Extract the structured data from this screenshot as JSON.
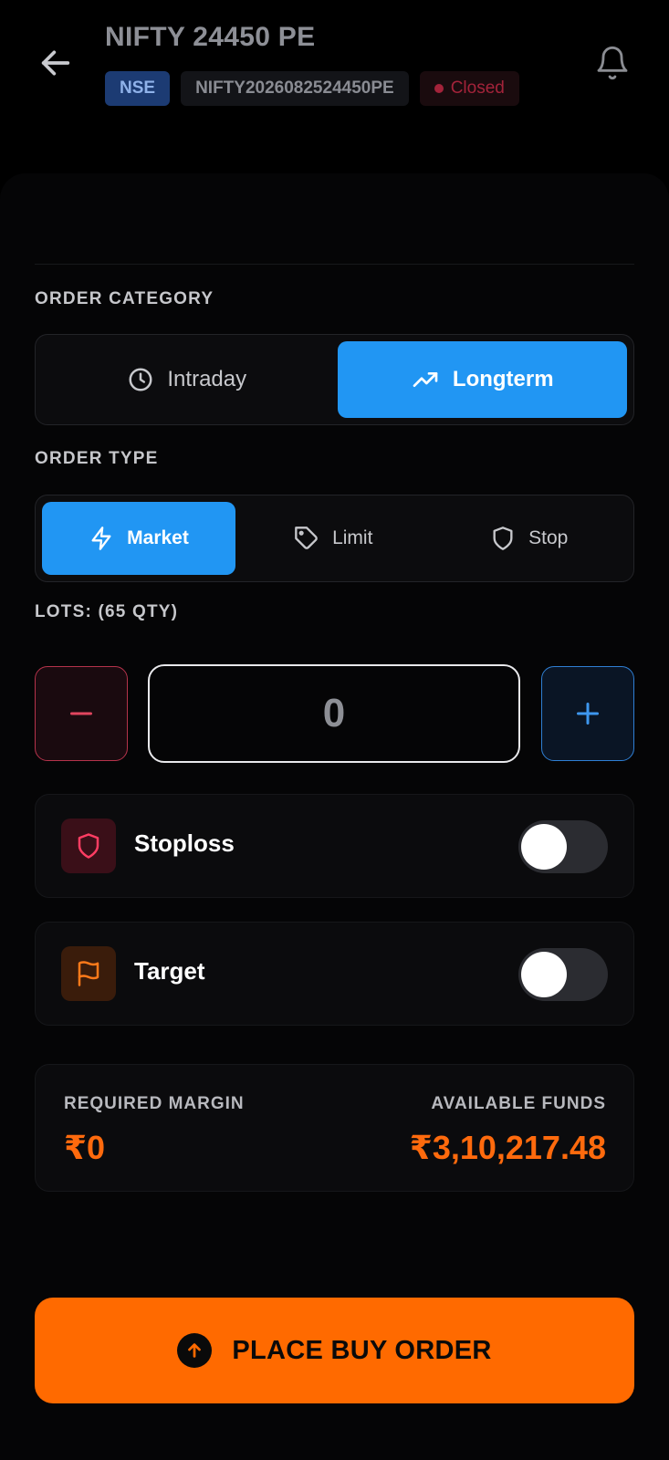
{
  "header": {
    "title": "NIFTY 24450 PE",
    "exchange": "NSE",
    "symbol": "NIFTY2026082524450PE",
    "status": "Closed"
  },
  "order_category": {
    "label": "ORDER CATEGORY",
    "options": [
      {
        "label": "Intraday",
        "icon": "clock-icon",
        "active": false
      },
      {
        "label": "Longterm",
        "icon": "trending-up-icon",
        "active": true
      }
    ]
  },
  "order_type": {
    "label": "ORDER TYPE",
    "options": [
      {
        "label": "Market",
        "icon": "lightning-icon",
        "active": true
      },
      {
        "label": "Limit",
        "icon": "tag-icon",
        "active": false
      },
      {
        "label": "Stop",
        "icon": "shield-icon",
        "active": false
      }
    ]
  },
  "lots": {
    "label": "LOTS: (65 QTY)",
    "value": "0"
  },
  "stoploss": {
    "label": "Stoploss",
    "enabled": false
  },
  "target": {
    "label": "Target",
    "enabled": false
  },
  "margin": {
    "required_label": "REQUIRED MARGIN",
    "required_value": "₹0",
    "available_label": "AVAILABLE FUNDS",
    "available_value": "₹3,10,217.48"
  },
  "place_order": {
    "label": "PLACE BUY ORDER"
  },
  "colors": {
    "accent_blue": "#2196f3",
    "accent_orange": "#ff6a00",
    "danger_red": "#b5334b",
    "background": "#000000"
  }
}
